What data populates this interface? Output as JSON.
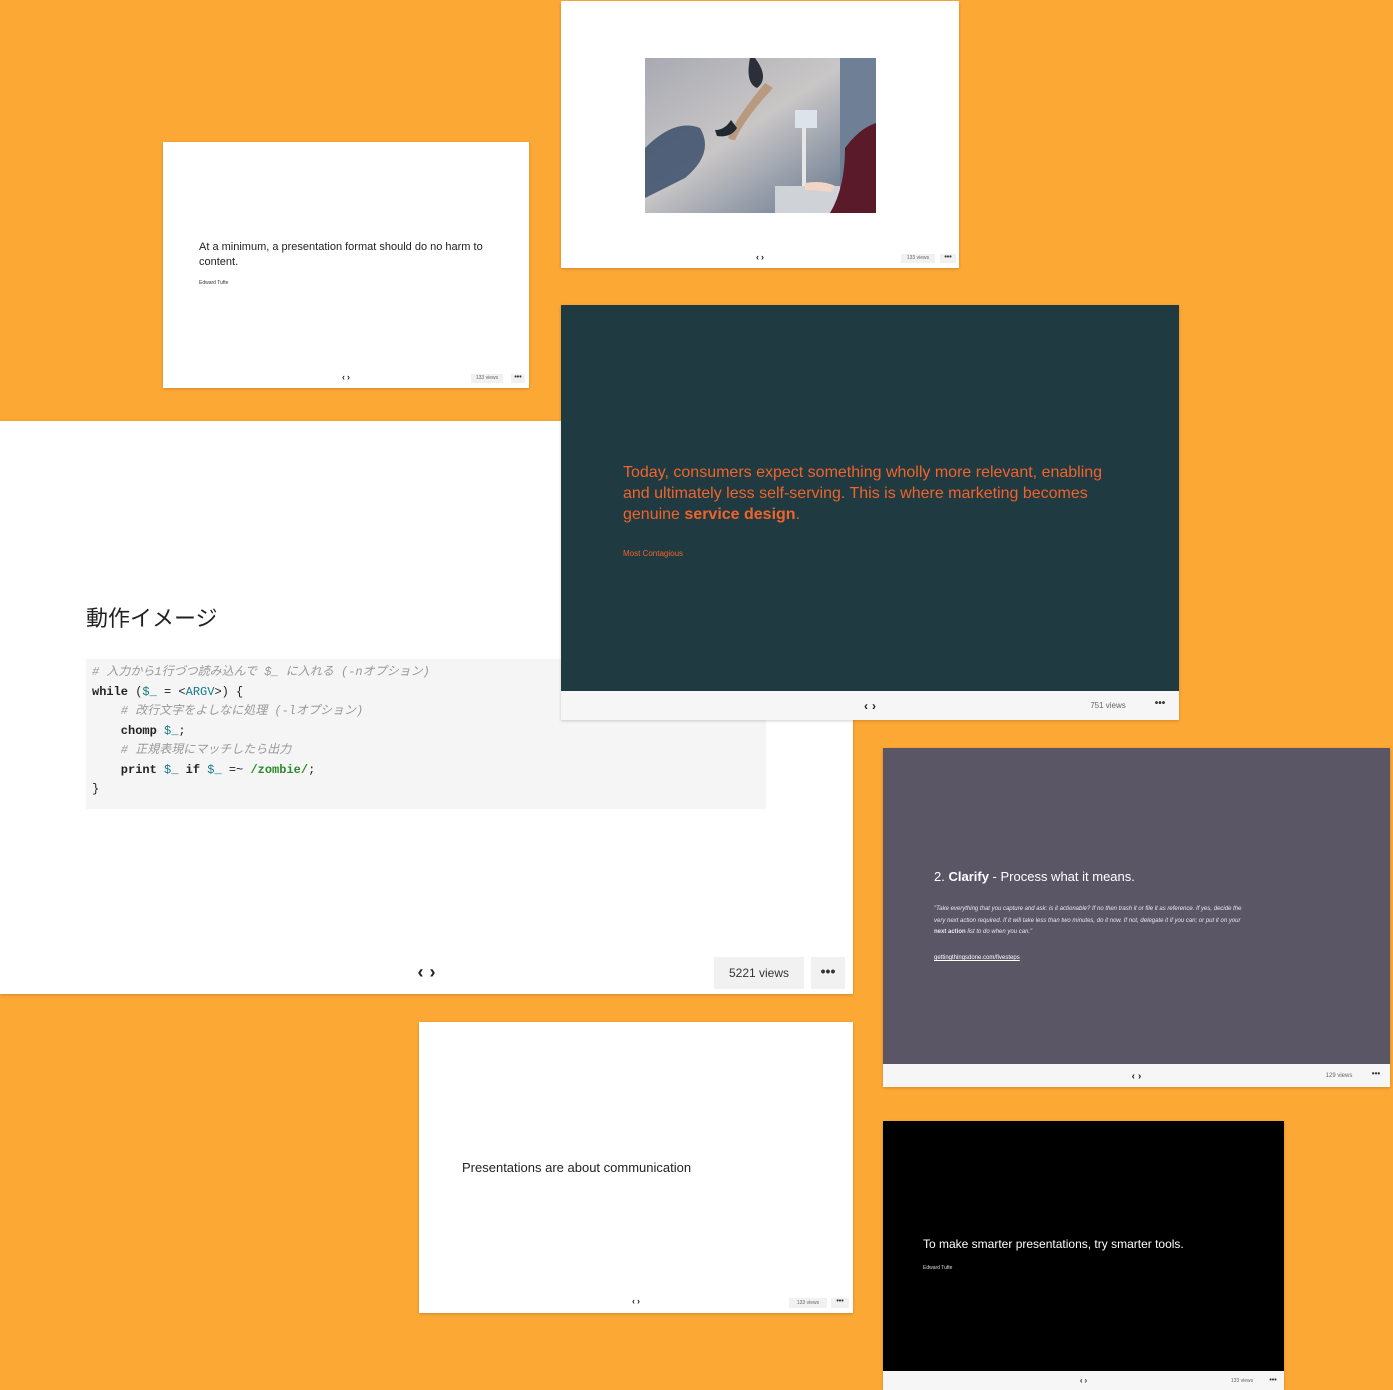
{
  "colors": {
    "background": "#fca835",
    "teal_slide": "#1f3a41",
    "teal_text": "#f2632a",
    "purple_slide": "#5a5666",
    "black_slide": "#000000"
  },
  "icons": {
    "prev": "‹",
    "next": "›",
    "more": "•••"
  },
  "cards": {
    "tufte_quote": {
      "quote": "At a minimum, a presentation format should do no harm to content.",
      "author": "Edward Tufte",
      "views": "133 views"
    },
    "photo_slide": {
      "views": "133 views"
    },
    "code_slide": {
      "title": "動作イメージ",
      "code": {
        "line1_comment": "# 入力から1行づつ読み込んで $_ に入れる (-nオプション)",
        "line2_kw": "while",
        "line2_a": " (",
        "line2_var": "$_",
        "line2_b": " = <",
        "line2_argv": "ARGV",
        "line2_c": ">) {",
        "line3_comment": "    # 改行文字をよしなに処理 (-lオプション)",
        "line4_kw": "    chomp ",
        "line4_var": "$_",
        "line4_end": ";",
        "line5_comment": "    # 正規表現にマッチしたら出力",
        "line6_kw": "    print ",
        "line6_var1": "$_",
        "line6_if": " if ",
        "line6_var2": "$_",
        "line6_op": " =~ ",
        "line6_re": "/zombie/",
        "line6_end": ";",
        "line7": "}"
      },
      "views": "5221 views"
    },
    "teal_quote": {
      "quote_plain": "Today, consumers expect something wholly more relevant, enabling and ultimately less self-serving. This is where marketing becomes genuine ",
      "quote_bold": "service design",
      "quote_end": ".",
      "author": "Most Contagious",
      "views": "751 views"
    },
    "clarify_slide": {
      "heading_num": "2. ",
      "heading_bold": "Clarify",
      "heading_rest": " - Process what it means.",
      "body_plain": "\"Take everything that you capture and ask: is it actionable? If no then trash it or file it as reference. If yes, decide the very next action required. If it will take less than two minutes, do it now. If not, delegate it if you can; or put it on your ",
      "body_bold": "next action",
      "body_end": " list to do when you can.\"",
      "link": "gettingthingsdone.com/fivesteps",
      "views": "129 views"
    },
    "communication_slide": {
      "text": "Presentations are about communication",
      "views": "133 views"
    },
    "smarter_tools": {
      "text": "To make smarter presentations, try smarter tools.",
      "author": "Edward Tufte",
      "views": "133 views"
    }
  }
}
